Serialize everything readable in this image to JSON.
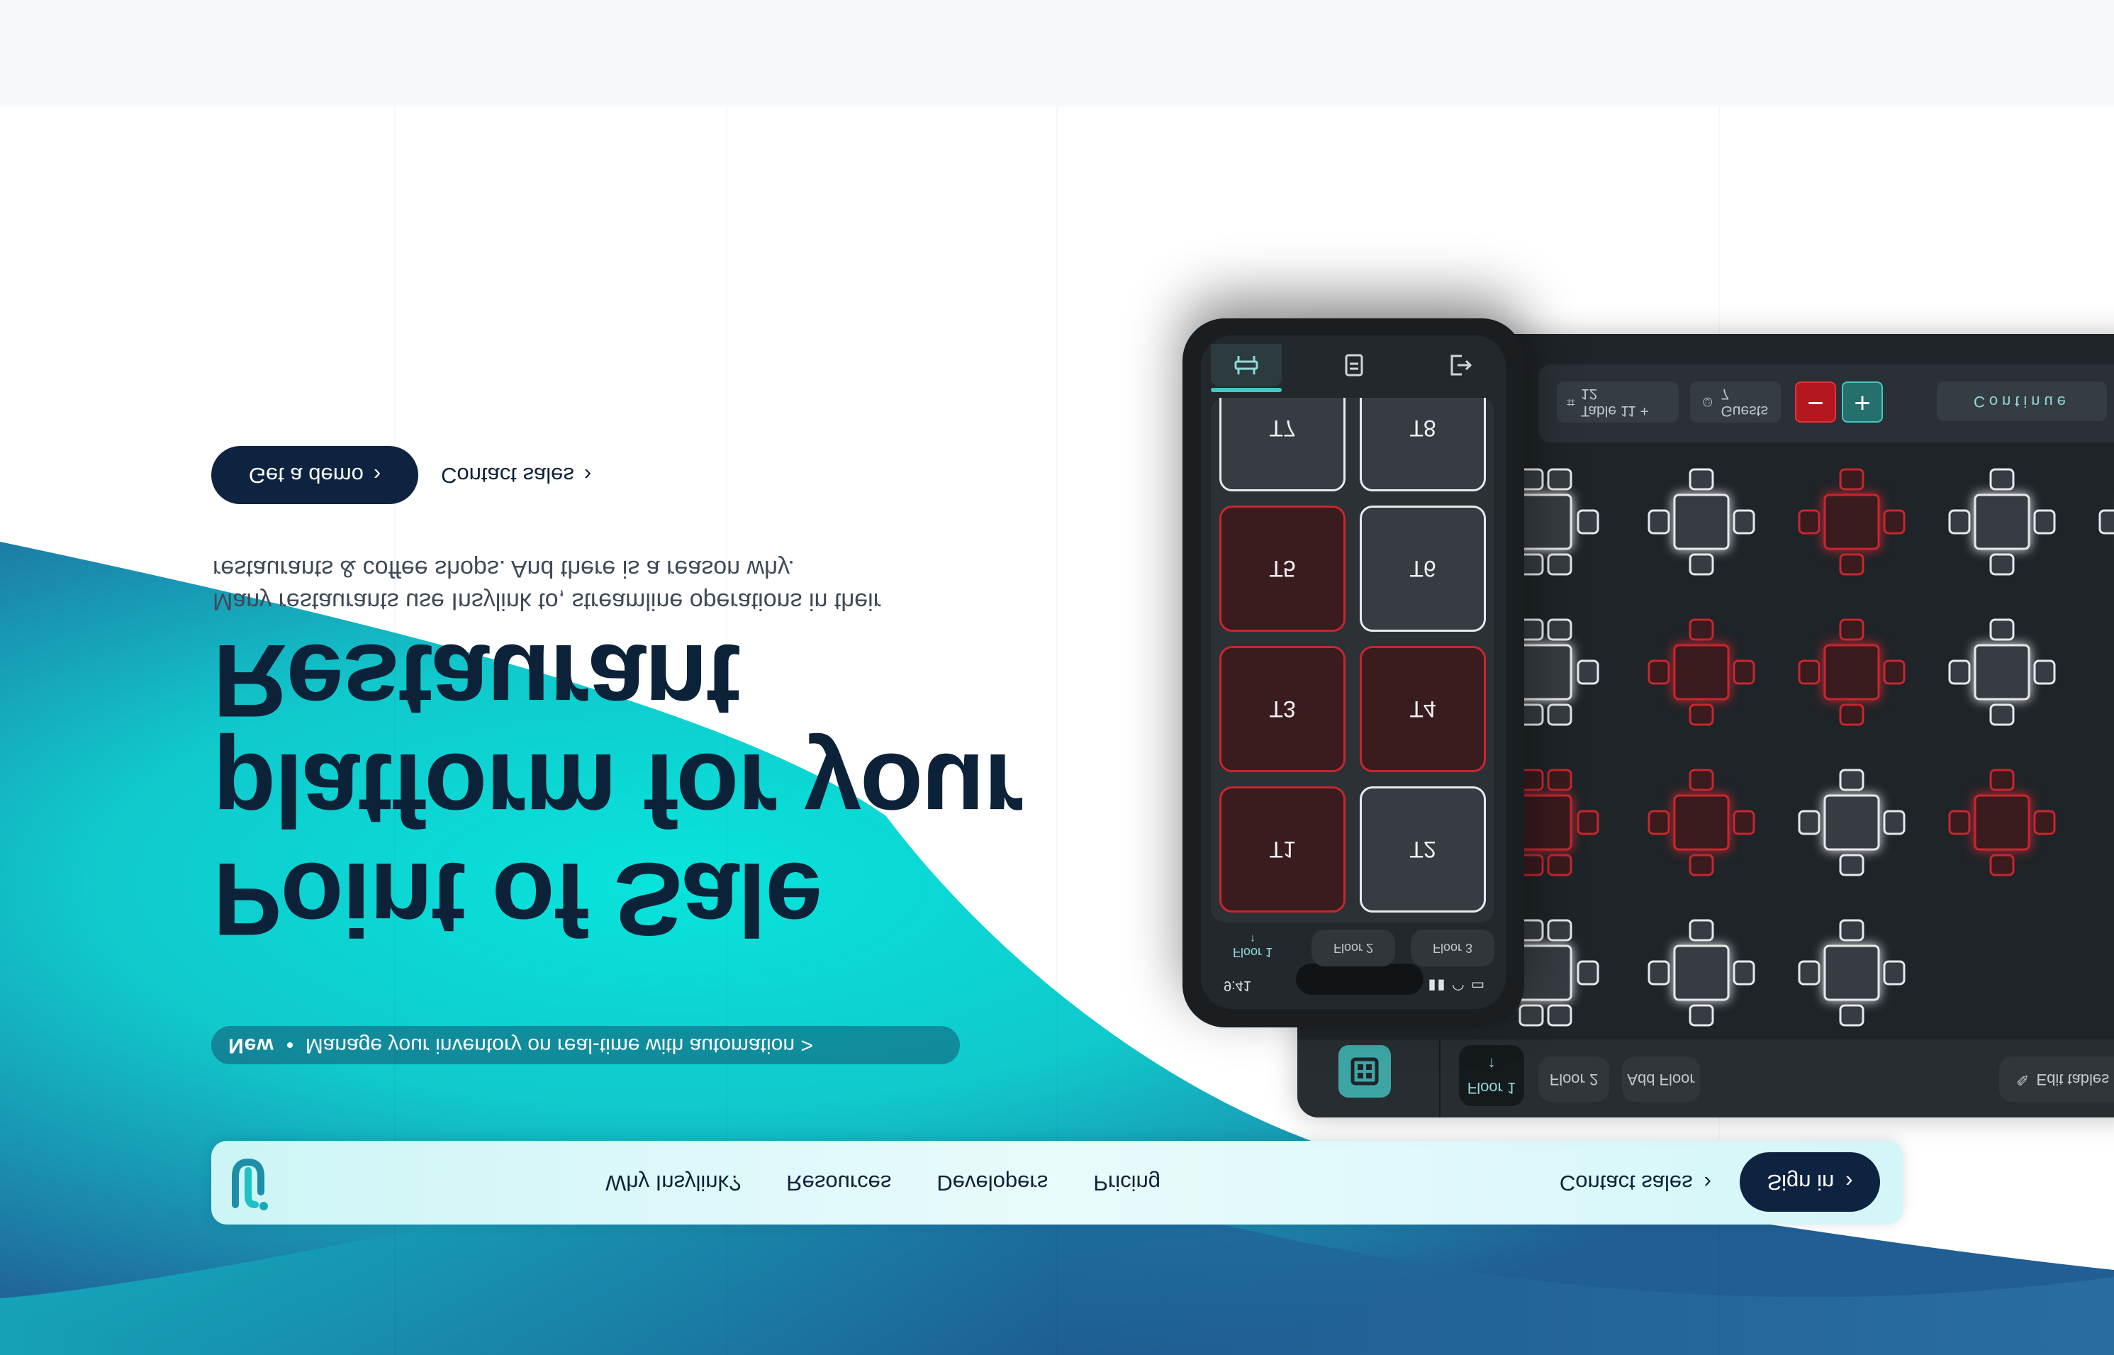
{
  "nav": {
    "links": [
      "Why Insylink?",
      "Resources",
      "Developers",
      "Pricing"
    ],
    "contact_label": "Contact sales",
    "signin_label": "Sign in"
  },
  "announcement": {
    "badge": "New",
    "text": "Manage your inventory on real-time with automation >"
  },
  "hero": {
    "headline_lines": [
      "Point of Sale",
      "platform for your",
      "Restaurant"
    ],
    "sub_lines": [
      "Many restaurants use Insylink to, streamline operations in their",
      "restaurants & coffee shops. And there is a reason why."
    ],
    "cta_demo": "Get a demo",
    "cta_contact": "Contact sales"
  },
  "tablet": {
    "floors": [
      "Floor 1",
      "Floor 2",
      "Add Floor"
    ],
    "edit_tables": "Edit tables",
    "table_chip": "Table 11 + 12",
    "guests_chip": "Guests 7",
    "minus": "−",
    "plus": "+",
    "continue": "Continue",
    "colors": {
      "free": "#e6e8ea",
      "busy": "#c8262f",
      "accent": "#46c7c3"
    }
  },
  "phone": {
    "time": "9:41",
    "floors": [
      "Floor 1",
      "Floor 2",
      "Floor 3"
    ],
    "tables": [
      {
        "label": "T1",
        "status": "busy"
      },
      {
        "label": "T2",
        "status": "free"
      },
      {
        "label": "T3",
        "status": "busy"
      },
      {
        "label": "T4",
        "status": "busy"
      },
      {
        "label": "T5",
        "status": "busy"
      },
      {
        "label": "T6",
        "status": "free"
      },
      {
        "label": "T7",
        "status": "free"
      },
      {
        "label": "T8",
        "status": "free"
      }
    ],
    "tabs": [
      "table-icon",
      "receipt-icon",
      "logout-icon"
    ]
  }
}
